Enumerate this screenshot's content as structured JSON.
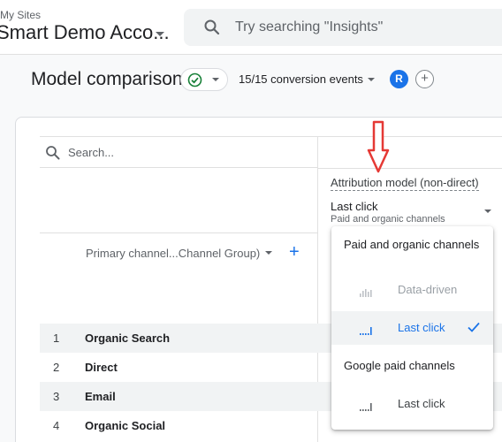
{
  "header": {
    "site_crumb": "My Sites",
    "account_name": "Smart Demo Acco...",
    "search_placeholder": "Try searching \"Insights\""
  },
  "toolbar": {
    "page_title": "Model comparison",
    "conversion_events": "15/15 conversion events",
    "avatar_initial": "R",
    "add_label": "+"
  },
  "table": {
    "search_placeholder": "Search...",
    "attribution_heading": "Attribution model (non-direct)",
    "model_value": "Last click",
    "model_sub": "Paid and organic channels",
    "dimension_label": "Primary channel...Channel Group)",
    "add_dimension": "+",
    "rows": [
      {
        "num": "1",
        "name": "Organic Search"
      },
      {
        "num": "2",
        "name": "Direct"
      },
      {
        "num": "3",
        "name": "Email"
      },
      {
        "num": "4",
        "name": "Organic Social"
      }
    ]
  },
  "dropdown": {
    "group1": "Paid and organic channels",
    "item_data_driven": "Data-driven",
    "item_last_click_1": "Last click",
    "group2": "Google paid channels",
    "item_last_click_2": "Last click"
  },
  "colors": {
    "accent": "#1a73e8",
    "annotation_arrow": "#e53935",
    "check_green": "#188038"
  }
}
